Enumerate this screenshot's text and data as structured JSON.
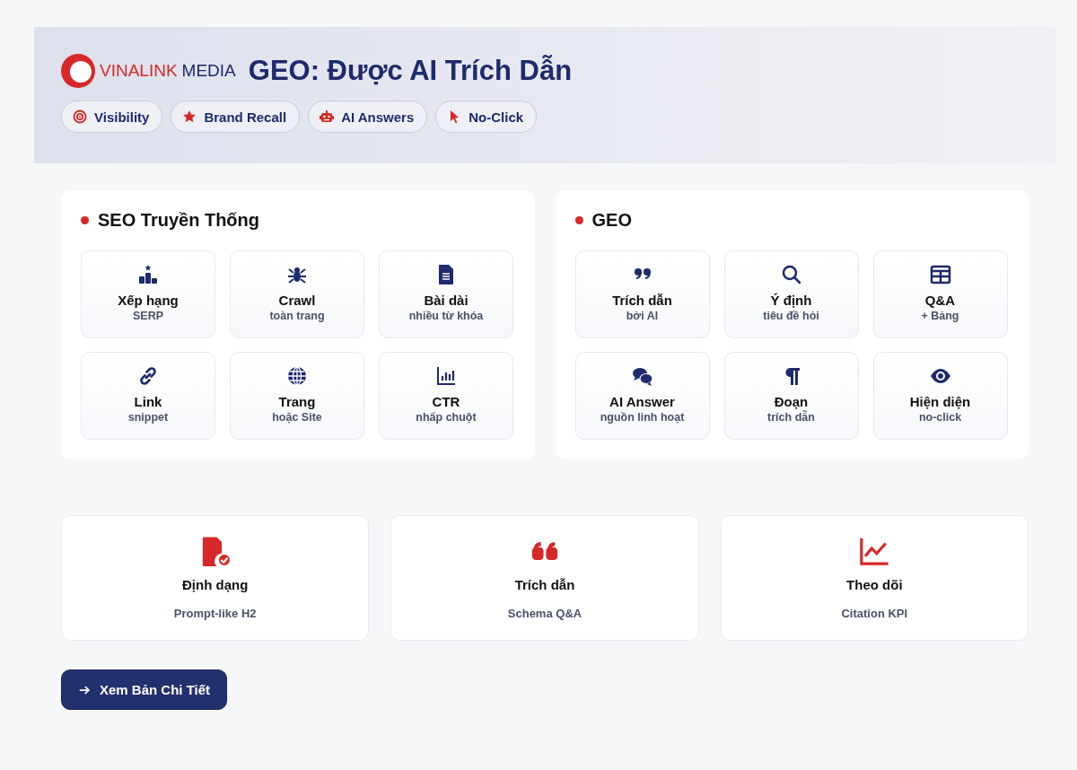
{
  "header": {
    "logo": {
      "brand": "VINALINK",
      "suffix": "MEDIA"
    },
    "title": "GEO: Được AI Trích Dẫn",
    "chips": [
      {
        "label": "Visibility"
      },
      {
        "label": "Brand Recall"
      },
      {
        "label": "AI Answers"
      },
      {
        "label": "No-Click"
      }
    ]
  },
  "panels": [
    {
      "title": "SEO Truyền Thống",
      "tiles": [
        {
          "title": "Xếp hạng",
          "subtitle": "SERP"
        },
        {
          "title": "Crawl",
          "subtitle": "toàn trang"
        },
        {
          "title": "Bài dài",
          "subtitle": "nhiều từ khóa"
        },
        {
          "title": "Link",
          "subtitle": "snippet"
        },
        {
          "title": "Trang",
          "subtitle": "hoặc Site"
        },
        {
          "title": "CTR",
          "subtitle": "nhấp chuột"
        }
      ]
    },
    {
      "title": "GEO",
      "tiles": [
        {
          "title": "Trích dẫn",
          "subtitle": "bởi AI"
        },
        {
          "title": "Ý định",
          "subtitle": "tiêu đề hỏi"
        },
        {
          "title": "Q&A",
          "subtitle": "+ Bảng"
        },
        {
          "title": "AI Answer",
          "subtitle": "nguồn linh hoạt"
        },
        {
          "title": "Đoạn",
          "subtitle": "trích dẫn"
        },
        {
          "title": "Hiện diện",
          "subtitle": "no-click"
        }
      ]
    }
  ],
  "features": [
    {
      "title": "Định dạng",
      "subtitle": "Prompt-like H2"
    },
    {
      "title": "Trích dẫn",
      "subtitle": "Schema Q&A"
    },
    {
      "title": "Theo dõi",
      "subtitle": "Citation KPI"
    }
  ],
  "cta": {
    "label": "Xem Bản Chi Tiết"
  }
}
